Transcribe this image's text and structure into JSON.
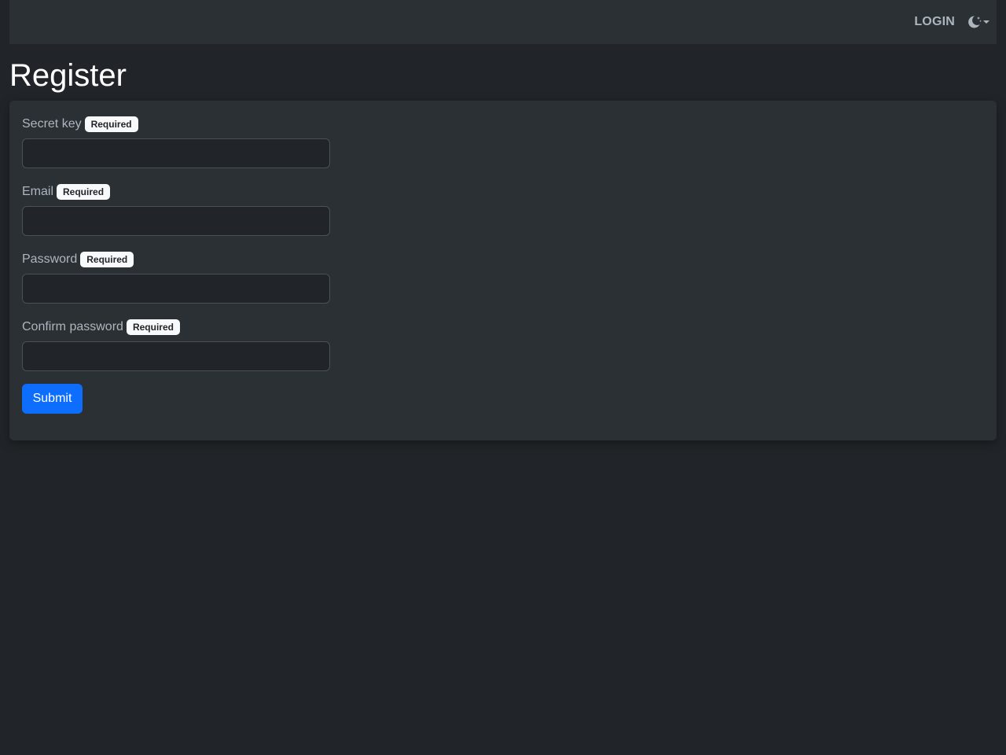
{
  "navbar": {
    "login_label": "LOGIN",
    "theme_icon": "moon-stars-icon",
    "dropdown_icon": "caret-down-icon"
  },
  "page": {
    "title": "Register"
  },
  "form": {
    "required_badge": "Required",
    "fields": [
      {
        "label": "Secret key",
        "value": "",
        "placeholder": ""
      },
      {
        "label": "Email",
        "value": "",
        "placeholder": ""
      },
      {
        "label": "Password",
        "value": "",
        "placeholder": ""
      },
      {
        "label": "Confirm password",
        "value": "",
        "placeholder": ""
      }
    ],
    "submit_label": "Submit"
  },
  "colors": {
    "background": "#212529",
    "surface": "#2b3035",
    "accent": "#0d6efd",
    "badge_bg": "#f8f9fa"
  }
}
